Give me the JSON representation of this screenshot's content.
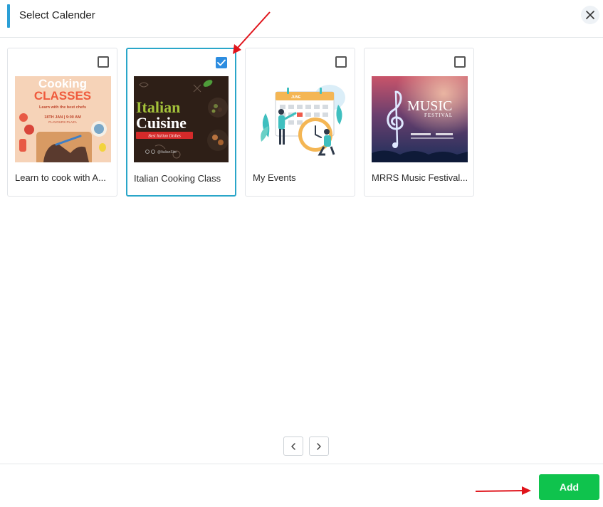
{
  "dialog": {
    "title": "Select Calender",
    "accent_color": "#2a9fd6"
  },
  "calendars": [
    {
      "label": "Learn to cook with A...",
      "selected": false,
      "thumbnail": {
        "line1": "Cooking",
        "line2": "CLASSES",
        "tagline": "Learn with the best chefs",
        "date": "18TH JAN | 9:00 AM",
        "venue": "FLAVOURS PLAZA"
      }
    },
    {
      "label": "Italian Cooking Class",
      "selected": true,
      "thumbnail": {
        "line1": "Italian",
        "line2": "Cuisine",
        "badge": "Best Italian Dishes",
        "handle": "@ItalianSite"
      }
    },
    {
      "label": "My Events",
      "selected": false,
      "thumbnail": {
        "month": "JUNE"
      }
    },
    {
      "label": "MRRS Music Festival...",
      "selected": false,
      "thumbnail": {
        "line1": "MUSIC",
        "line2": "FESTIVAL"
      }
    }
  ],
  "pagination": {
    "prev_icon": "chevron-left-icon",
    "next_icon": "chevron-right-icon"
  },
  "footer": {
    "add_label": "Add",
    "add_color": "#0fc34d"
  },
  "colors": {
    "selected_border": "#2aa6c9",
    "checkbox_checked": "#2d8de0",
    "annotation_arrow": "#e0141b"
  }
}
